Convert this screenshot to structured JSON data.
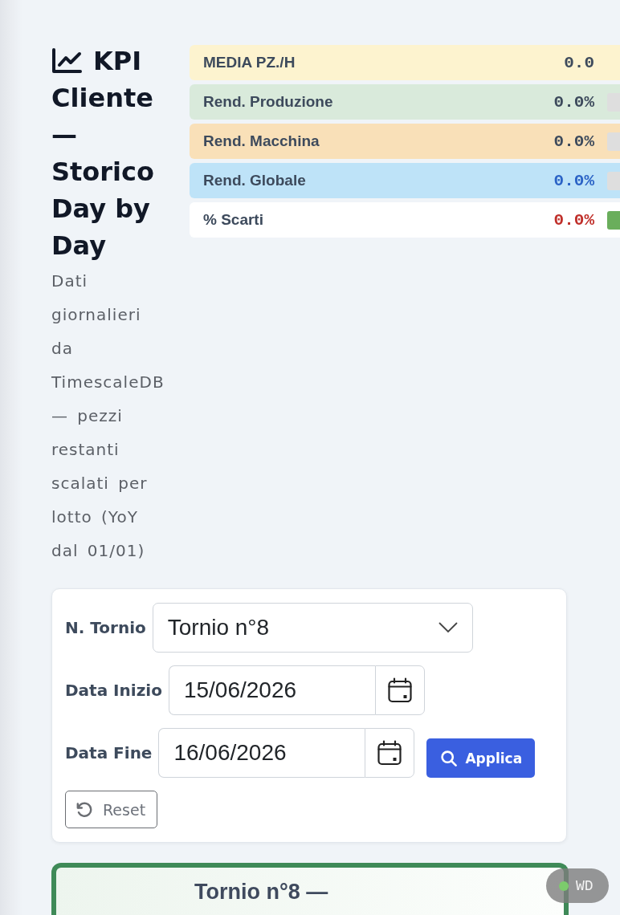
{
  "title_lines": [
    "KPI",
    "Cliente — Storico Day by Day"
  ],
  "subtitle": "Dati giornalieri da TimescaleDB — pezzi restanti scalati per lotto (YoY dal 01/01)",
  "kpis": [
    {
      "label": "MEDIA PZ./H",
      "value": {
        "text": "0.0",
        "color": "#3d4a5c"
      },
      "color": "#fdf3cf"
    },
    {
      "label": "Rend. Produzione",
      "value": {
        "text": "0.0%",
        "color": "#3d4a5c"
      },
      "color": "#d9eadb",
      "indicator": {
        "color": "#dedede"
      }
    },
    {
      "label": "Rend. Macchina",
      "value": {
        "text": "0.0%",
        "color": "#3d4a5c"
      },
      "color": "#f9e0b8",
      "indicator": {
        "color": "#dedede"
      }
    },
    {
      "label": "Rend. Globale",
      "value": {
        "text": "0.0%",
        "color": "#2b63c6"
      },
      "color": "#bee3f8",
      "indicator": {
        "color": "#dedede"
      }
    },
    {
      "label": "% Scarti",
      "value": {
        "text": "0.0%",
        "color": "#c0302b"
      },
      "color": "#ffffff",
      "indicator": {
        "color": "#6aae5c"
      }
    }
  ],
  "filters": {
    "fields": [
      {
        "kind": "select",
        "label": "N. Tornio",
        "value": "Tornio n°8"
      },
      {
        "kind": "date",
        "label": "Data Inizio",
        "value": "15/06/2026"
      },
      {
        "kind": "date",
        "label": "Data Fine",
        "value": "16/06/2026"
      }
    ],
    "buttons": [
      {
        "kind": "primary",
        "label": "Applica"
      },
      {
        "kind": "secondary",
        "label": "Reset"
      }
    ]
  },
  "machine_card": {
    "title": "Tornio n°8 —"
  },
  "status_badge": {
    "label": "WD",
    "color": "#7ccb6c"
  }
}
